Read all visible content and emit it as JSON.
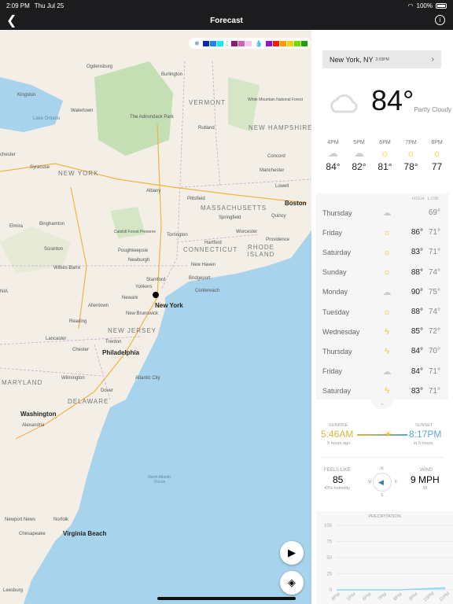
{
  "status": {
    "time": "2:09 PM",
    "date": "Thu Jul 25",
    "battery": "100%"
  },
  "nav": {
    "title": "Forecast",
    "back_icon": "chevron-left-icon",
    "info_icon": "info-icon"
  },
  "map": {
    "legend": {
      "snow_colors": [
        "#0a2aa8",
        "#1f84f0",
        "#18e8f0"
      ],
      "mix_colors": [
        "#8e1a6b",
        "#d65fb0",
        "#f9c6ef"
      ],
      "rain_colors": [
        "#9a10c8",
        "#ff1a00",
        "#ff9a00",
        "#f7d000",
        "#6edb00",
        "#20a000"
      ]
    },
    "labels": {
      "ogdensburg": "Ogdensburg",
      "burlington": "Burlington",
      "kingston": "Kingston",
      "lake_ontario": "Lake Ontario",
      "watertown": "Watertown",
      "vermont": "VERMONT",
      "white_mtn": "White Mountain National Forest",
      "adirondack": "The Adirondack Park",
      "new_hampshire": "NEW HAMPSHIRE",
      "rochester": "chester",
      "syracuse": "Syracuse",
      "new_york_state": "NEW YORK",
      "rutland": "Rutland",
      "manchester": "Manchester",
      "concord": "Concord",
      "albany": "Albany",
      "lowell": "Lowell",
      "boston": "Boston",
      "massachusetts": "MASSACHUSETTS",
      "pittsfield": "Pittsfield",
      "springfield": "Springfield",
      "worcester": "Worcester",
      "quincy": "Quincy",
      "binghamton": "Binghamton",
      "elmira": "Elmira",
      "catskill": "Catskill Forest Preserve",
      "providence": "Providence",
      "torrington": "Torrington",
      "hartford": "Hartford",
      "connecticut": "CONNECTICUT",
      "rhode_island": "RHODE ISLAND",
      "scranton": "Scranton",
      "poughkeepsie": "Poughkeepsie",
      "newburgh": "Newburgh",
      "new_haven": "New Haven",
      "wilkes_barre": "Wilkes-Barre",
      "stamford": "Stamford",
      "bridgeport": "Bridgeport",
      "yonkers": "Yonkers",
      "newark": "Newark",
      "new_york_city": "New York",
      "centereach": "Centereach",
      "allentown": "Allentown",
      "reading": "Reading",
      "new_brunswick": "New Brunswick",
      "new_jersey": "NEW JERSEY",
      "trenton": "Trenton",
      "philadelphia": "Philadelphia",
      "chester": "Chester",
      "lancaster": "Lancaster",
      "maryland": "MARYLAND",
      "wilmington": "Wilmington",
      "delaware": "DELAWARE",
      "atlantic_city": "Atlantic City",
      "dover": "Dover",
      "washington": "Washington",
      "alexandria": "Alexandria",
      "ocean": "North Atlantic Ocean",
      "newport_news": "Newport News",
      "norfolk": "Norfolk",
      "chesapeake": "Chesapeake",
      "virginia_beach": "Virginia Beach",
      "nia": "NIA",
      "leesburg": "Leesburg"
    },
    "play_icon": "play-icon",
    "layers_icon": "layers-icon"
  },
  "location": {
    "name": "New York, NY",
    "time": "3:03PM"
  },
  "current": {
    "temp": "84°",
    "condition": "Partly Cloudy",
    "icon": "cloud-icon"
  },
  "hourly": [
    {
      "hour": "4PM",
      "icon": "cloud",
      "temp": "84°"
    },
    {
      "hour": "5PM",
      "icon": "cloud",
      "temp": "82°"
    },
    {
      "hour": "6PM",
      "icon": "sun",
      "temp": "81°"
    },
    {
      "hour": "7PM",
      "icon": "sun",
      "temp": "78°"
    },
    {
      "hour": "8PM",
      "icon": "sun",
      "temp": "77"
    }
  ],
  "daily_header": {
    "high": "HIGH",
    "low": "LOW"
  },
  "daily": [
    {
      "day": "Thursday",
      "icon": "partly-cloudy",
      "high": "",
      "low": "69°"
    },
    {
      "day": "Friday",
      "icon": "sun",
      "high": "86°",
      "low": "71°"
    },
    {
      "day": "Saturday",
      "icon": "sun",
      "high": "83°",
      "low": "71°"
    },
    {
      "day": "Sunday",
      "icon": "sun",
      "high": "88°",
      "low": "74°"
    },
    {
      "day": "Monday",
      "icon": "cloud",
      "high": "90°",
      "low": "75°"
    },
    {
      "day": "Tuesday",
      "icon": "sun",
      "high": "88°",
      "low": "74°"
    },
    {
      "day": "Wednesday",
      "icon": "thunderstorm",
      "high": "85°",
      "low": "72°"
    },
    {
      "day": "Thursday",
      "icon": "thunderstorm",
      "high": "84°",
      "low": "70°"
    },
    {
      "day": "Friday",
      "icon": "cloud",
      "high": "84°",
      "low": "71°"
    },
    {
      "day": "Saturday",
      "icon": "thunderstorm",
      "high": "83°",
      "low": "71°"
    }
  ],
  "sun": {
    "sunrise_label": "SUNRISE",
    "sunrise": "5:46AM",
    "sunrise_sub": "9 hours ago",
    "sunset_label": "SUNSET",
    "sunset": "8:17PM",
    "sunset_sub": "in 5 hours",
    "sunrise_color": "#d9b53a",
    "sunset_color": "#5aa9cf"
  },
  "feels": {
    "label": "FEELS LIKE",
    "value": "85",
    "humidity": "43% humidity"
  },
  "compass": {
    "n": "N",
    "s": "S",
    "e": "E",
    "w": "W"
  },
  "wind": {
    "label": "WIND",
    "value": "9 MPH",
    "dir": "W"
  },
  "chart_data": {
    "type": "area",
    "title": "PRECIPITATION",
    "categories": [
      "4PM",
      "5PM",
      "6PM",
      "7PM",
      "8PM",
      "9PM",
      "10PM",
      "11PM"
    ],
    "values": [
      0,
      0,
      0,
      0,
      0,
      1,
      2,
      3
    ],
    "ylim": [
      0,
      100
    ],
    "yticks": [
      "100",
      "75",
      "50",
      "25",
      "0"
    ],
    "color": "#8fd3f5"
  }
}
